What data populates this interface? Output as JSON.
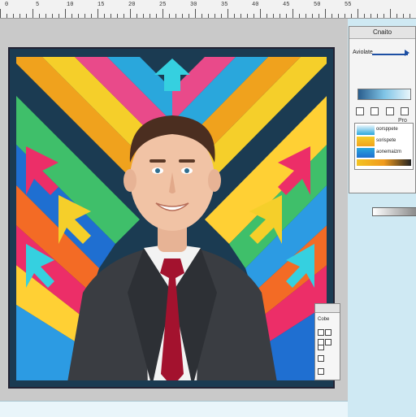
{
  "ruler": {
    "labels": [
      "0",
      "5",
      "10",
      "15",
      "20",
      "25",
      "30",
      "35",
      "40",
      "45",
      "50",
      "55"
    ]
  },
  "panel": {
    "title": "Cnaito",
    "field_label": "Aviolate",
    "pro_label": "Pro",
    "layers": [
      {
        "name": "oorsppete"
      },
      {
        "name": "sorispete"
      },
      {
        "name": "aonemaizm"
      }
    ],
    "colors": {
      "accent": "#1d4fa3"
    }
  },
  "tool_palette": {
    "title": "Cobe"
  },
  "canvas": {
    "subject": "portrait",
    "colors": {
      "background": "#1b3b52",
      "suit": "#3a3d42",
      "tie": "#a3122e",
      "shirt": "#f3f3f3"
    }
  }
}
